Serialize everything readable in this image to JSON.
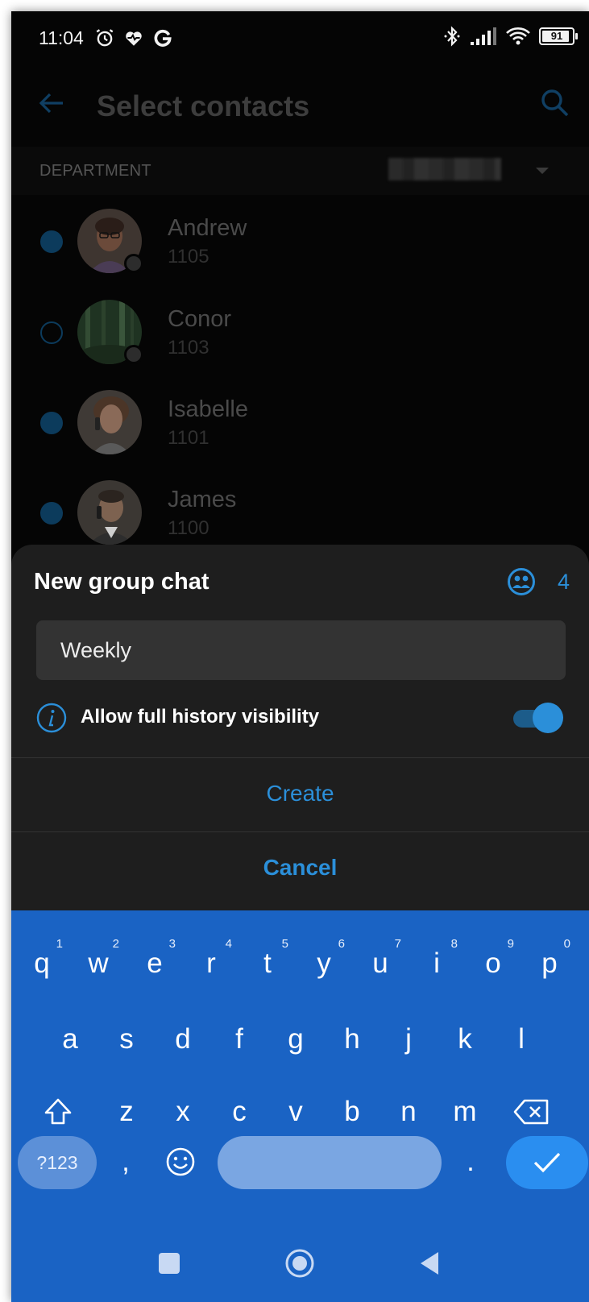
{
  "status_bar": {
    "time": "11:04",
    "battery": "91"
  },
  "app_bar": {
    "title": "Select contacts"
  },
  "filter": {
    "label": "DEPARTMENT"
  },
  "contacts": [
    {
      "name": "Andrew",
      "ext": "1105",
      "selected": true
    },
    {
      "name": "Conor",
      "ext": "1103",
      "selected": false
    },
    {
      "name": "Isabelle",
      "ext": "1101",
      "selected": true
    },
    {
      "name": "James",
      "ext": "1100",
      "selected": true
    }
  ],
  "sheet": {
    "title": "New group chat",
    "member_count": "4",
    "name_value": "Weekly",
    "history_label": "Allow full history visibility",
    "history_enabled": true,
    "create_label": "Create",
    "cancel_label": "Cancel"
  },
  "keyboard": {
    "row1": [
      {
        "k": "q",
        "h": "1"
      },
      {
        "k": "w",
        "h": "2"
      },
      {
        "k": "e",
        "h": "3"
      },
      {
        "k": "r",
        "h": "4"
      },
      {
        "k": "t",
        "h": "5"
      },
      {
        "k": "y",
        "h": "6"
      },
      {
        "k": "u",
        "h": "7"
      },
      {
        "k": "i",
        "h": "8"
      },
      {
        "k": "o",
        "h": "9"
      },
      {
        "k": "p",
        "h": "0"
      }
    ],
    "row2": [
      "a",
      "s",
      "d",
      "f",
      "g",
      "h",
      "j",
      "k",
      "l"
    ],
    "row3": [
      "z",
      "x",
      "c",
      "v",
      "b",
      "n",
      "m"
    ],
    "symbols_label": "?123",
    "comma": ",",
    "period": "."
  },
  "colors": {
    "accent": "#2b8fd9",
    "keyboard_bg": "#1a63c4",
    "sheet_bg": "#1e1e1e"
  }
}
